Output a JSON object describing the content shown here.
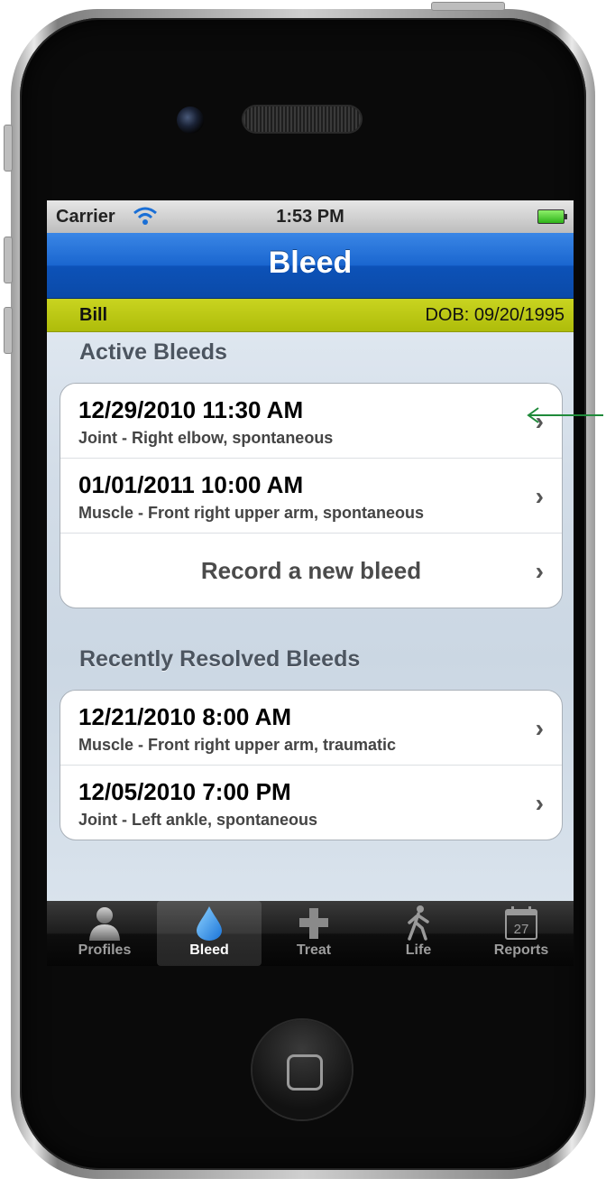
{
  "status_bar": {
    "carrier": "Carrier",
    "time": "1:53 PM"
  },
  "nav": {
    "title": "Bleed"
  },
  "profile": {
    "name": "Bill",
    "dob": "DOB: 09/20/1995"
  },
  "sections": {
    "active": {
      "header": "Active Bleeds",
      "items": [
        {
          "title": "12/29/2010 11:30 AM",
          "subtitle": "Joint - Right elbow, spontaneous"
        },
        {
          "title": "01/01/2011 10:00 AM",
          "subtitle": "Muscle - Front right upper arm, spontaneous"
        }
      ],
      "new_label": "Record a new bleed"
    },
    "resolved": {
      "header": "Recently Resolved Bleeds",
      "items": [
        {
          "title": "12/21/2010 8:00 AM",
          "subtitle": "Muscle - Front right upper arm, traumatic"
        },
        {
          "title": "12/05/2010 7:00 PM",
          "subtitle": "Joint - Left ankle, spontaneous"
        }
      ]
    }
  },
  "tabs": [
    {
      "label": "Profiles",
      "icon": "person-icon"
    },
    {
      "label": "Bleed",
      "icon": "drop-icon",
      "selected": true
    },
    {
      "label": "Treat",
      "icon": "cross-icon"
    },
    {
      "label": "Life",
      "icon": "walking-icon"
    },
    {
      "label": "Reports",
      "icon": "calendar-icon",
      "badge": "27"
    }
  ],
  "colors": {
    "nav": "#1a66cf",
    "profile_bar": "#c0cc14",
    "annotation": "#1f8a3a"
  }
}
